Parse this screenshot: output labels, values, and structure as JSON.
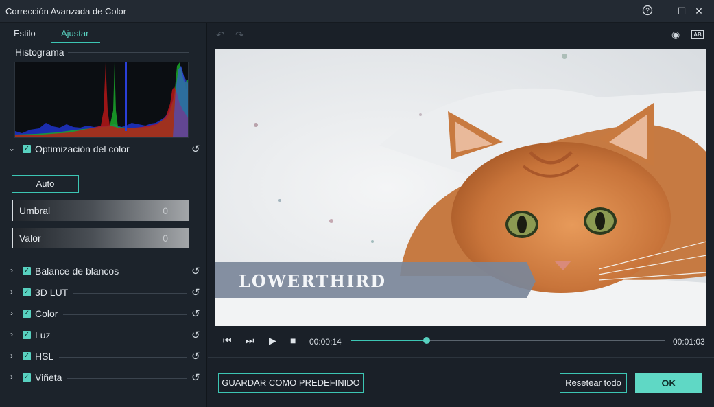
{
  "window": {
    "title": "Corrección Avanzada de Color",
    "help_icon": "?",
    "minimize_icon": "–",
    "maximize_icon": "☐",
    "close_icon": "✕"
  },
  "tabs": [
    {
      "label": "Estilo",
      "active": false
    },
    {
      "label": "Ajustar",
      "active": true
    }
  ],
  "histogram": {
    "label": "Histograma"
  },
  "color_optimization": {
    "label": "Optimización del color",
    "checked": true,
    "auto_label": "Auto",
    "threshold": {
      "label": "Umbral",
      "value": "0"
    },
    "amount": {
      "label": "Valor",
      "value": "0"
    }
  },
  "sections": [
    {
      "label": "Balance de blancos",
      "checked": true
    },
    {
      "label": "3D LUT",
      "checked": true
    },
    {
      "label": "Color",
      "checked": true
    },
    {
      "label": "Luz",
      "checked": true
    },
    {
      "label": "HSL",
      "checked": true
    },
    {
      "label": "Viñeta",
      "checked": true
    }
  ],
  "preview": {
    "lowerthird_text": "LOWERTHIRD"
  },
  "player": {
    "current_time": "00:00:14",
    "total_time": "00:01:03",
    "progress": 0.24
  },
  "footer": {
    "save_preset_label": "GUARDAR COMO PREDEFINIDO",
    "reset_all_label": "Resetear todo",
    "ok_label": "OK"
  },
  "colors": {
    "accent": "#3cc6b4",
    "ok_button": "#5fd8c5",
    "background": "#1a2028"
  }
}
